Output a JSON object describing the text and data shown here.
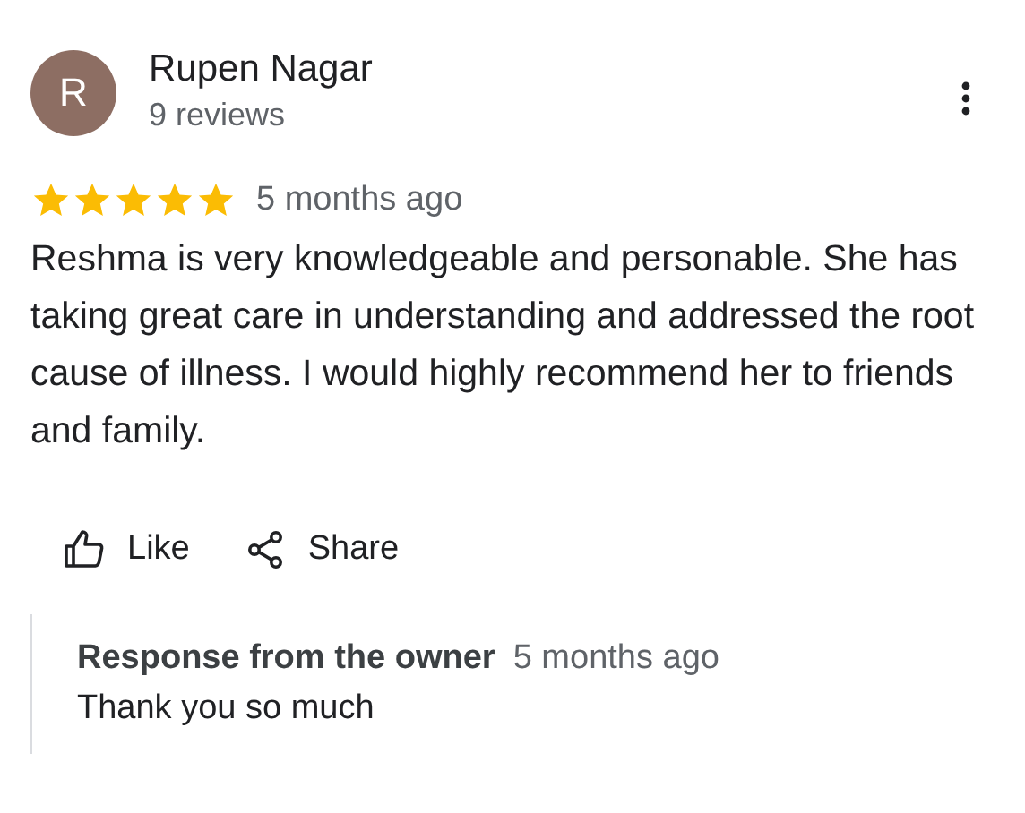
{
  "reviewer": {
    "avatar_letter": "R",
    "name": "Rupen Nagar",
    "reviews": "9 reviews"
  },
  "rating": {
    "stars": 5,
    "time": "5 months ago"
  },
  "text": "Reshma is very knowledgeable and personable. She has taking great care in understanding and addressed the root cause of illness. I would highly recommend her to friends and family.",
  "actions": [
    {
      "kind": "like",
      "label": "Like"
    },
    {
      "kind": "share",
      "label": "Share"
    }
  ],
  "response": {
    "title": "Response from the owner",
    "time": "5 months ago",
    "text": "Thank you so much"
  }
}
